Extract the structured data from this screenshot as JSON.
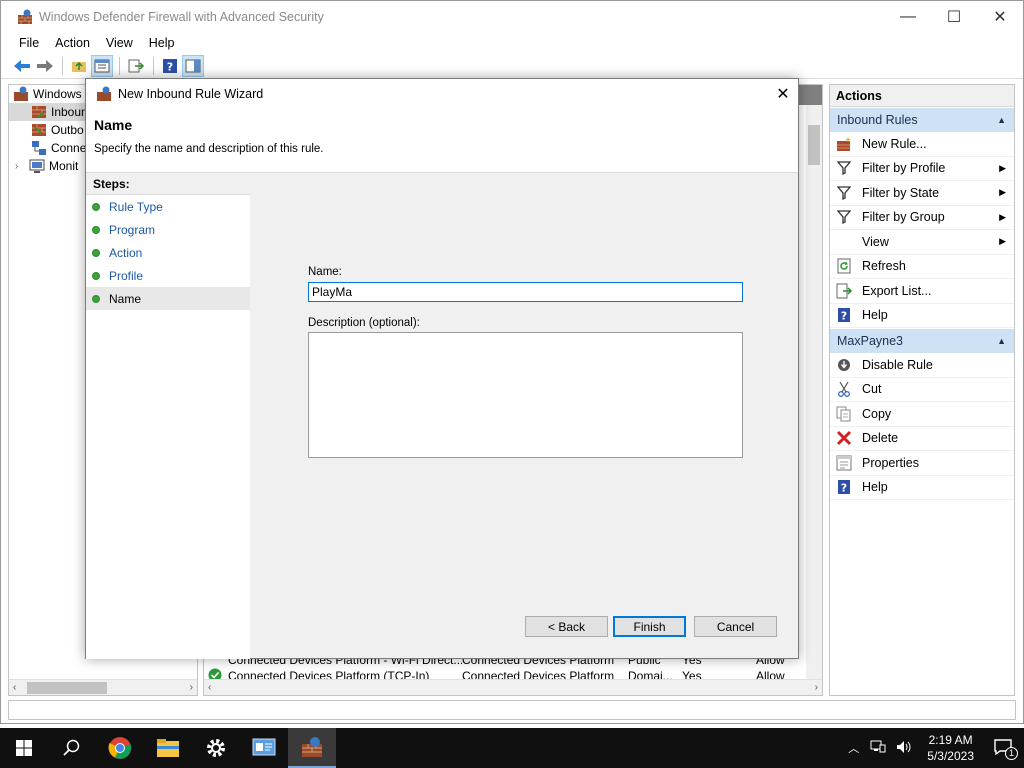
{
  "window": {
    "title": "Windows Defender Firewall with Advanced Security",
    "minimize": "—",
    "maximize": "☐",
    "close": "✕"
  },
  "menu": [
    "File",
    "Action",
    "View",
    "Help"
  ],
  "tree": {
    "items": [
      {
        "label": "Windows",
        "icon": "firewall-icon"
      },
      {
        "label": "Inboun",
        "icon": "inbound-rules-icon"
      },
      {
        "label": "Outbo",
        "icon": "outbound-rules-icon"
      },
      {
        "label": "Conne",
        "icon": "connection-security-icon"
      },
      {
        "label": "Monit",
        "icon": "monitoring-icon"
      }
    ]
  },
  "list": {
    "rows": [
      {
        "name": "Connected Devices Platform - Wi-Fi Direct...",
        "group": "Connected Devices Platform",
        "profile": "Public",
        "enabled": "Yes",
        "action": "Allow"
      },
      {
        "name": "Connected Devices Platform (TCP-In)",
        "group": "Connected Devices Platform",
        "profile": "Domai...",
        "enabled": "Yes",
        "action": "Allow"
      }
    ]
  },
  "actions": {
    "title": "Actions",
    "section1": "Inbound Rules",
    "items1": [
      {
        "label": "New Rule...",
        "icon": "new-rule-icon",
        "submenu": false
      },
      {
        "label": "Filter by Profile",
        "icon": "filter-icon",
        "submenu": true
      },
      {
        "label": "Filter by State",
        "icon": "filter-icon",
        "submenu": true
      },
      {
        "label": "Filter by Group",
        "icon": "filter-icon",
        "submenu": true
      },
      {
        "label": "View",
        "icon": "",
        "submenu": true
      },
      {
        "label": "Refresh",
        "icon": "refresh-icon",
        "submenu": false
      },
      {
        "label": "Export List...",
        "icon": "export-icon",
        "submenu": false
      },
      {
        "label": "Help",
        "icon": "help-icon",
        "submenu": false
      }
    ],
    "section2": "MaxPayne3",
    "items2": [
      {
        "label": "Disable Rule",
        "icon": "disable-icon"
      },
      {
        "label": "Cut",
        "icon": "cut-icon"
      },
      {
        "label": "Copy",
        "icon": "copy-icon"
      },
      {
        "label": "Delete",
        "icon": "delete-icon"
      },
      {
        "label": "Properties",
        "icon": "properties-icon"
      },
      {
        "label": "Help",
        "icon": "help-icon"
      }
    ]
  },
  "wizard": {
    "title": "New Inbound Rule Wizard",
    "heading": "Name",
    "subheading": "Specify the name and description of this rule.",
    "steps_title": "Steps:",
    "steps": [
      "Rule Type",
      "Program",
      "Action",
      "Profile",
      "Name"
    ],
    "name_label": "Name:",
    "name_value": "PlayMa",
    "desc_label": "Description (optional):",
    "desc_value": "",
    "back": "< Back",
    "finish": "Finish",
    "cancel": "Cancel"
  },
  "taskbar": {
    "time": "2:19 AM",
    "date": "5/3/2023",
    "notifications": "1"
  },
  "colors": {
    "accent": "#0078d7",
    "section_bg": "#cfe2f5",
    "step_dot": "#3ea23e"
  }
}
